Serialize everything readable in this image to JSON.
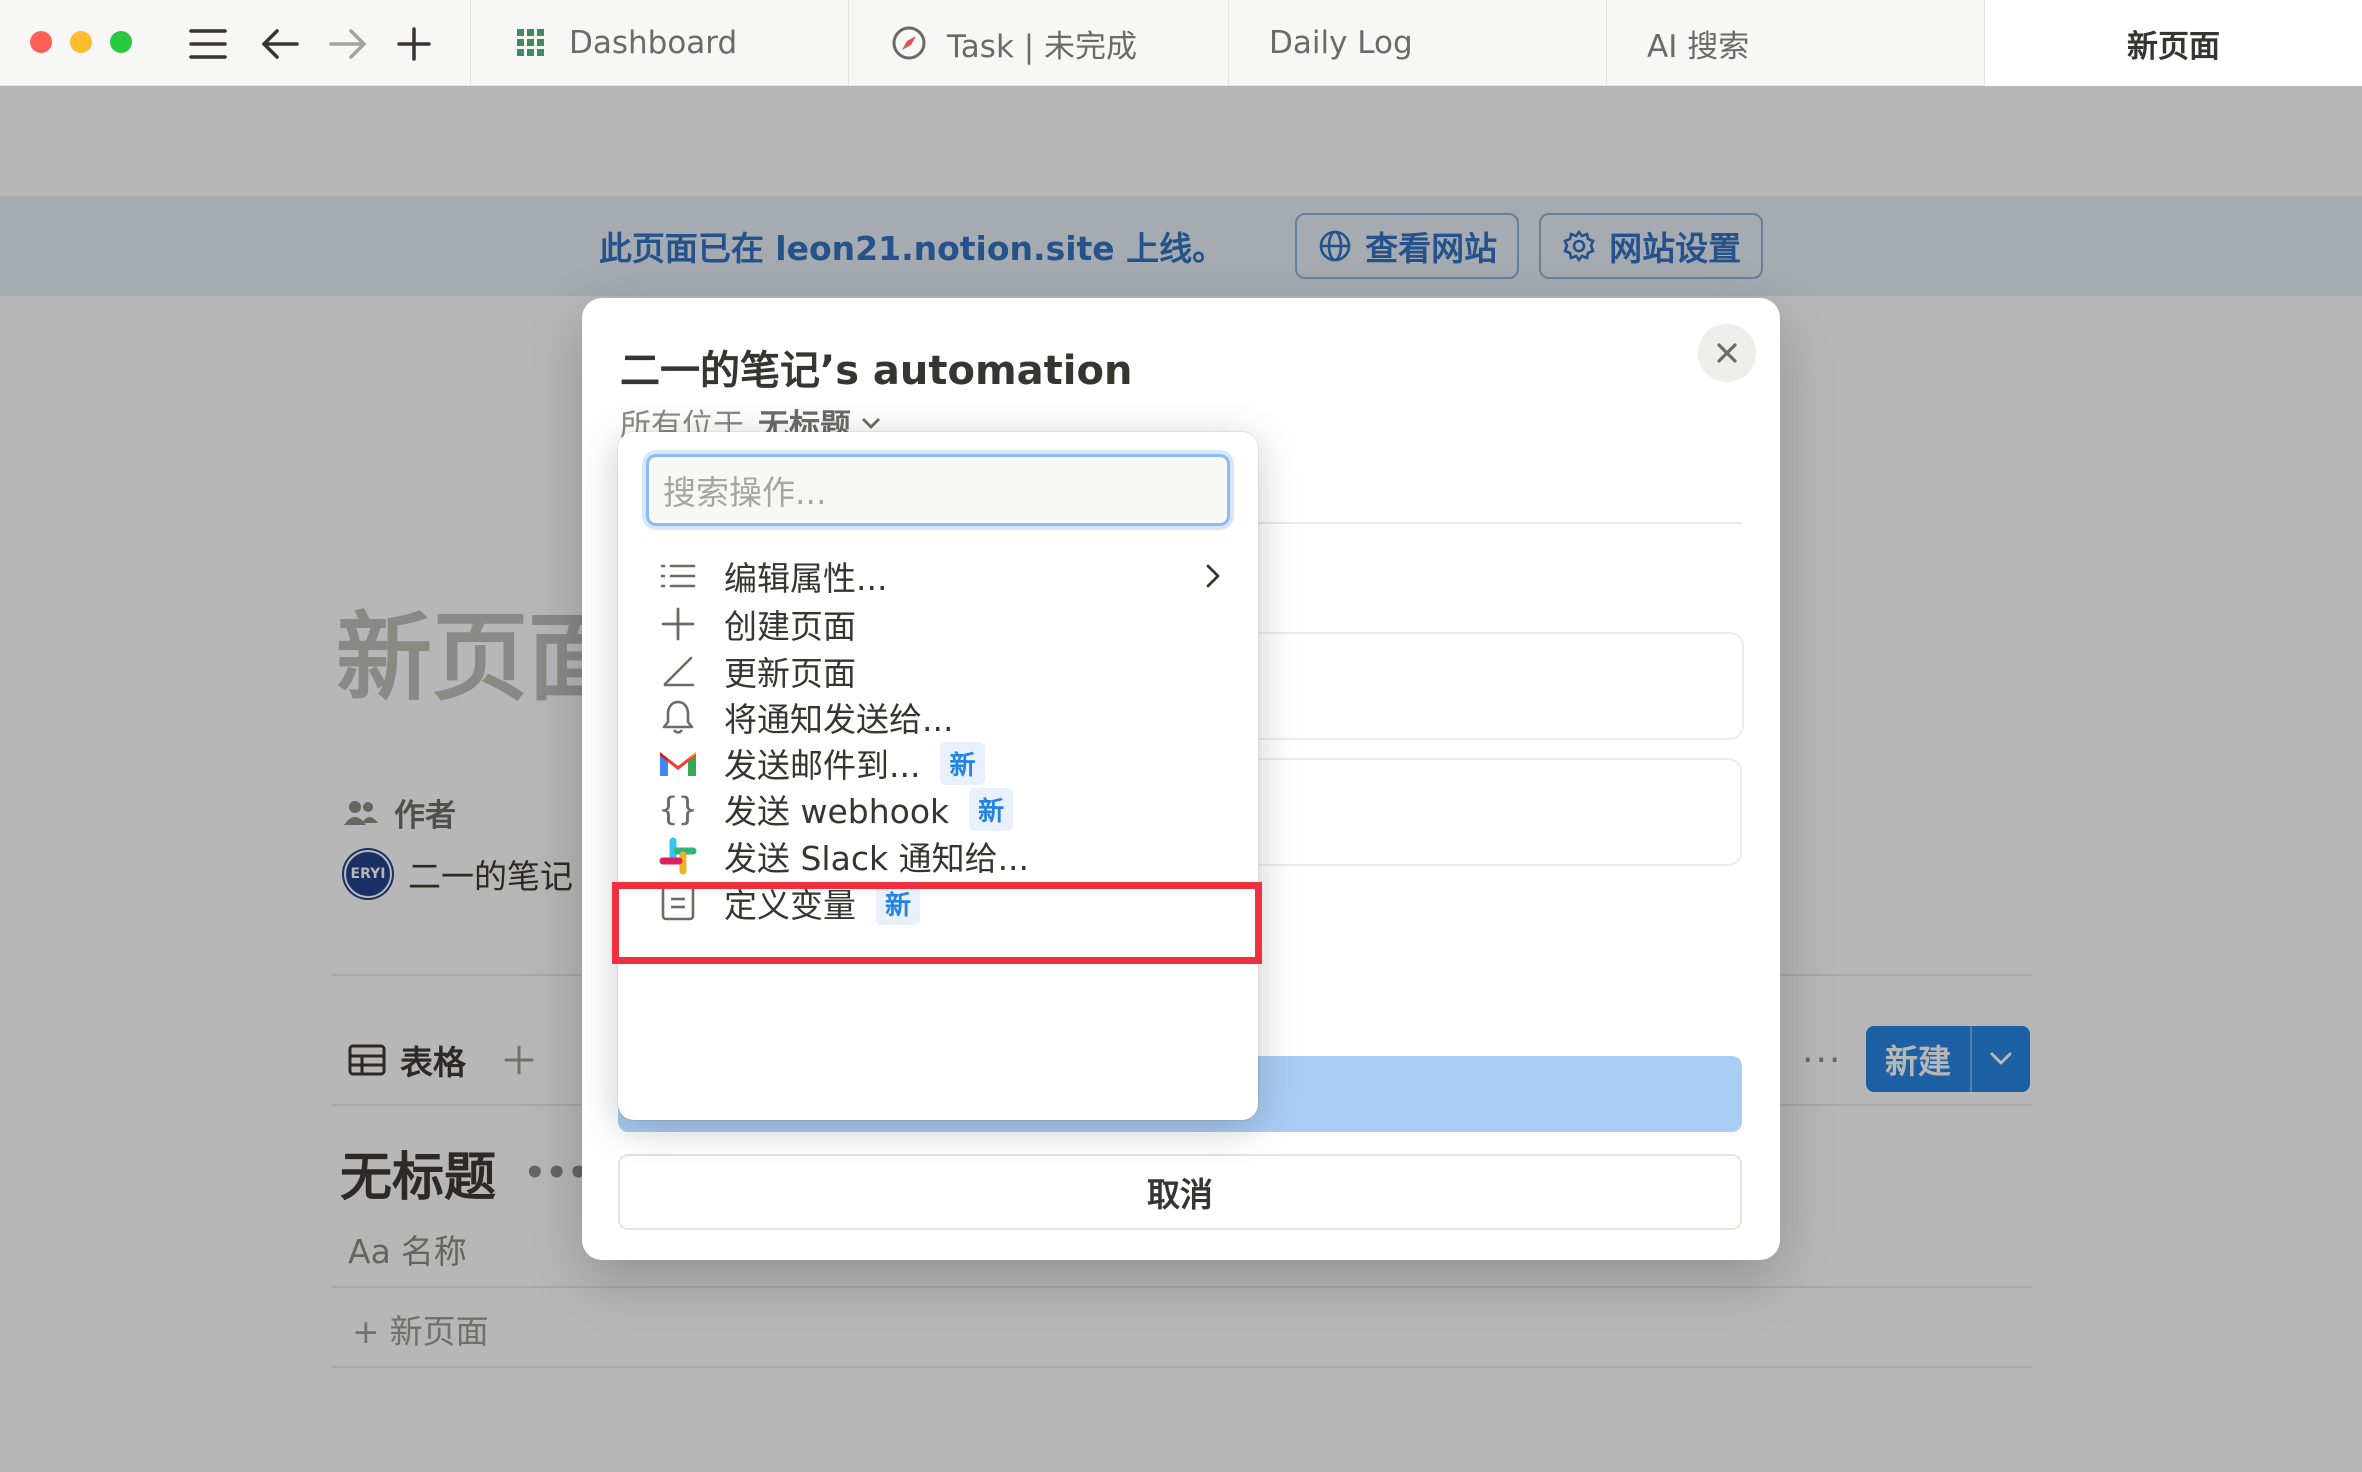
{
  "titlebar": {
    "tabs": [
      {
        "label": "Dashboard",
        "icon": "grid-icon"
      },
      {
        "label": "Task | 未完成",
        "icon": "compass-icon"
      },
      {
        "label": "Daily Log",
        "icon": ""
      },
      {
        "label": "AI 搜索",
        "icon": ""
      },
      {
        "label": "新页面",
        "icon": "",
        "active": true
      }
    ]
  },
  "banner": {
    "text": "此页面已在 leon21.notion.site 上线。",
    "view_site_label": "查看网站",
    "site_settings_label": "网站设置"
  },
  "page": {
    "title": "新页面",
    "author_label": "作者",
    "author_name": "二一的笔记",
    "avatar_text": "ERYI",
    "view_tab_label": "表格",
    "view_title": "无标题",
    "column_name": "名称",
    "column_prefix": "Aa",
    "new_row_label": "新页面",
    "new_button_label": "新建",
    "more_dots": "···"
  },
  "modal": {
    "title": "二一的笔记’s automation",
    "subtitle_prefix": "所有位于",
    "subtitle_db": "无标题",
    "cancel_label": "取消"
  },
  "menu": {
    "search_placeholder": "搜索操作...",
    "badge_new": "新",
    "items": [
      {
        "label": "编辑属性...",
        "icon": "list-icon",
        "has_submenu": true,
        "badge": false
      },
      {
        "label": "创建页面",
        "icon": "plus-icon",
        "has_submenu": false,
        "badge": false
      },
      {
        "label": "更新页面",
        "icon": "pencil-icon",
        "has_submenu": false,
        "badge": false
      },
      {
        "label": "将通知发送给...",
        "icon": "bell-icon",
        "has_submenu": false,
        "badge": false
      },
      {
        "label": "发送邮件到...",
        "icon": "gmail-icon",
        "has_submenu": false,
        "badge": true
      },
      {
        "label": "发送 webhook",
        "icon": "braces-icon",
        "has_submenu": false,
        "badge": true,
        "highlighted": true
      },
      {
        "label": "发送 Slack 通知给...",
        "icon": "slack-icon",
        "has_submenu": false,
        "badge": false
      },
      {
        "label": "定义变量",
        "icon": "variable-icon",
        "has_submenu": false,
        "badge": true
      }
    ]
  },
  "colors": {
    "accent": "#2383e2",
    "highlight_border": "#f0303f",
    "banner_text": "#2e6fbf"
  }
}
